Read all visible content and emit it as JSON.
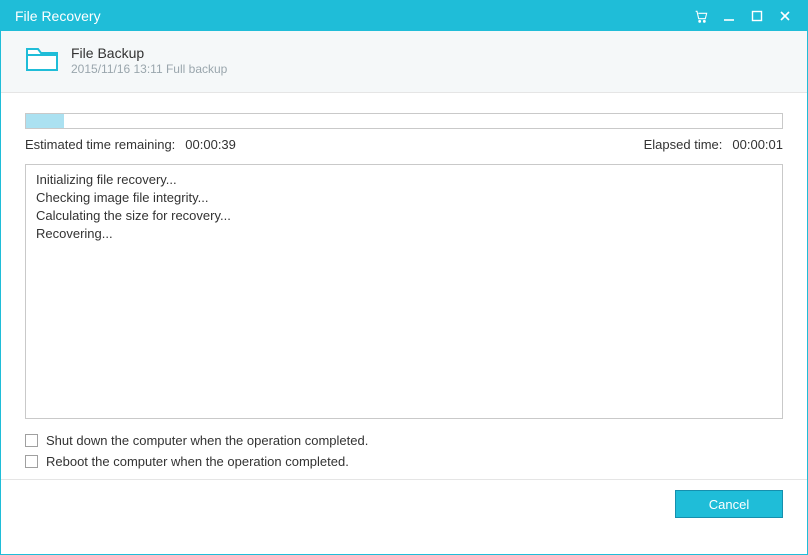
{
  "window": {
    "title": "File Recovery"
  },
  "header": {
    "title": "File Backup",
    "subtitle": "2015/11/16 13:11 Full backup"
  },
  "progress": {
    "percent": 5
  },
  "timing": {
    "remaining_label": "Estimated time remaining:",
    "remaining_value": "00:00:39",
    "elapsed_label": "Elapsed time:",
    "elapsed_value": "00:00:01"
  },
  "log": [
    "Initializing file recovery...",
    "Checking image file integrity...",
    "Calculating the size for recovery...",
    "Recovering..."
  ],
  "options": {
    "shutdown_label": "Shut down the computer when the operation completed.",
    "reboot_label": "Reboot the computer when the operation completed."
  },
  "footer": {
    "cancel_label": "Cancel"
  }
}
